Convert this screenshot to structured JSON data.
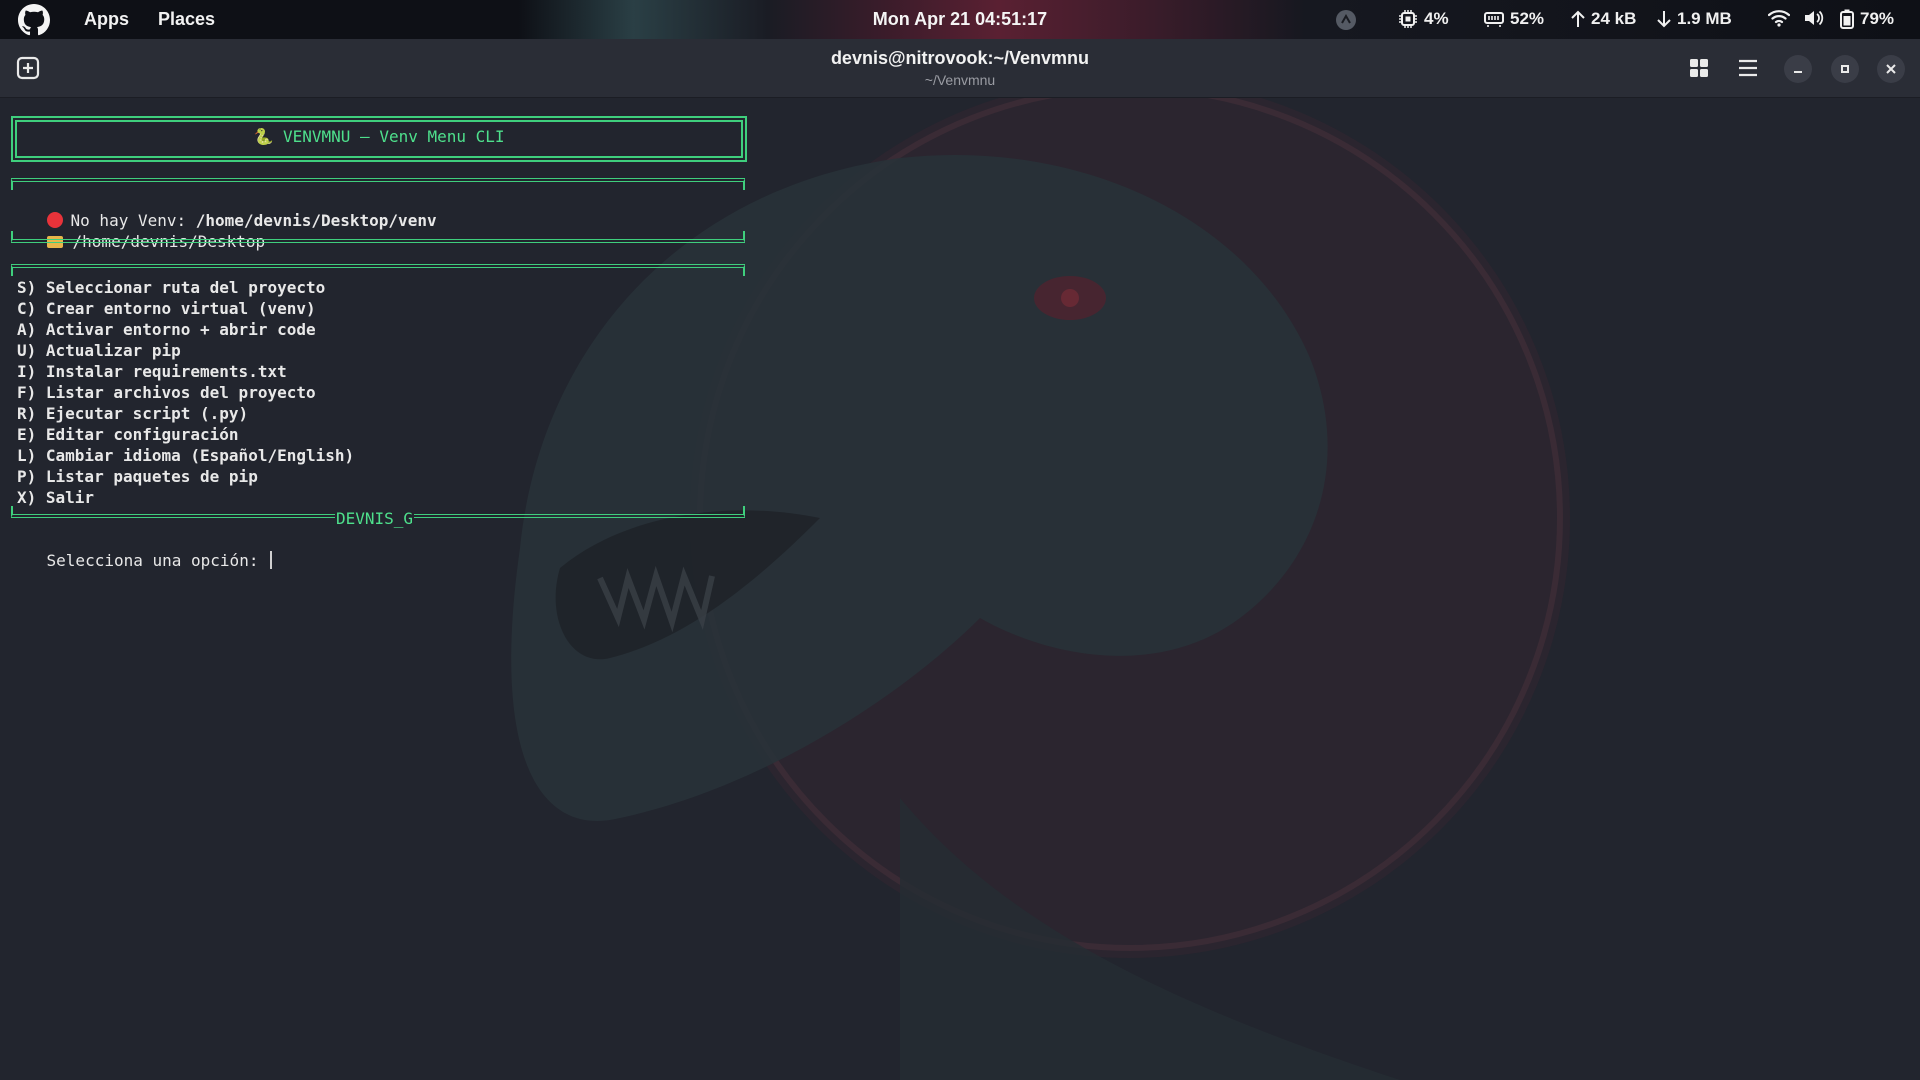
{
  "topbar": {
    "apps_label": "Apps",
    "places_label": "Places",
    "clock": "Mon Apr 21  04:51:17",
    "cpu": "4%",
    "mem": "52%",
    "upload": "24 kB",
    "download": "1.9 MB",
    "battery": "79%"
  },
  "window": {
    "title": "devnis@nitrovook:~/Venvmnu",
    "subtitle": "~/Venvmnu"
  },
  "terminal": {
    "banner": "🐍 VENVMNU – Venv Menu CLI",
    "status_prefix": "No hay Venv: ",
    "status_path": "/home/devnis/Desktop/venv",
    "folder_path": "/home/devnis/Desktop",
    "menu": [
      "S) Seleccionar ruta del proyecto",
      "C) Crear entorno virtual (venv)",
      "A) Activar entorno + abrir code",
      "U) Actualizar pip",
      "I) Instalar requirements.txt",
      "F) Listar archivos del proyecto",
      "R) Ejecutar script (.py)",
      "E) Editar configuración",
      "L) Cambiar idioma (Español/English)",
      "P) Listar paquetes de pip",
      "X) Salir"
    ],
    "footer_label": "DEVNIS_G",
    "prompt": "Selecciona una opción: "
  },
  "colors": {
    "accent_green": "#3fcf7d",
    "status_red": "#e8333a",
    "folder_yellow": "#e8b64a"
  },
  "icons": [
    "github-icon",
    "terminal-tab-icon",
    "cpu-icon",
    "memory-icon",
    "wifi-icon",
    "volume-icon",
    "battery-icon",
    "grid-icon",
    "menu-icon",
    "minimize-icon",
    "maximize-icon",
    "close-icon"
  ]
}
